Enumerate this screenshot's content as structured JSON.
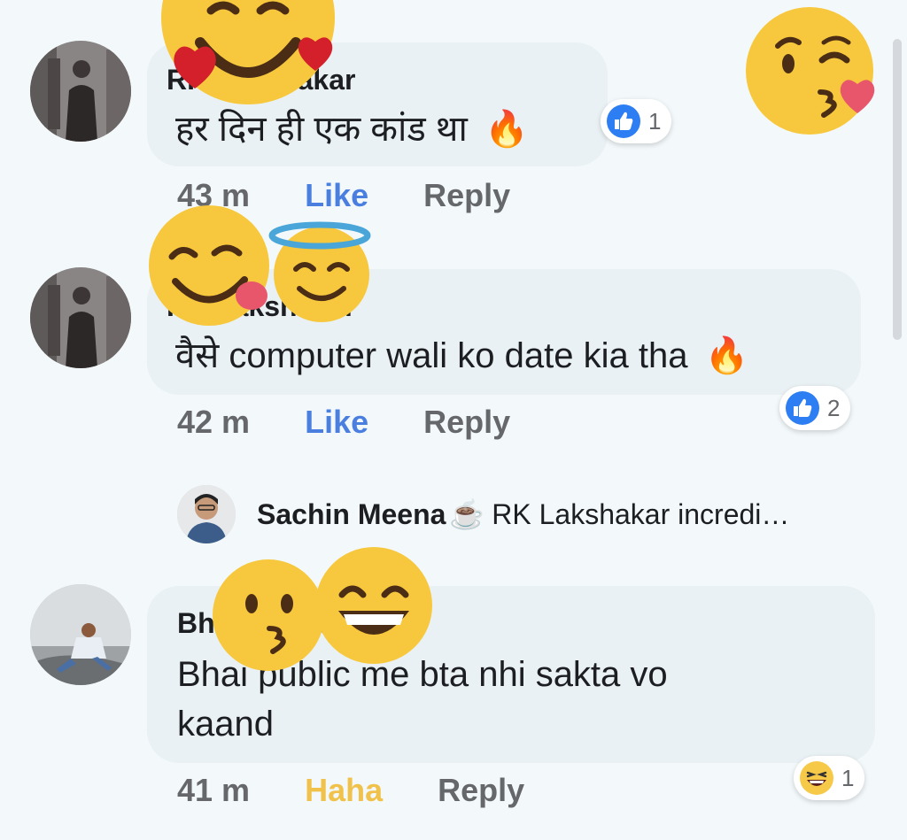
{
  "comments": [
    {
      "author": "RK Lakshakar",
      "text": "हर दिन ही एक कांड था",
      "emoji": "🔥",
      "time": "43 m",
      "action": "Like",
      "reply": "Reply",
      "reaction_count": "1",
      "reaction_type": "like-icon"
    },
    {
      "author": "RK Lakshakar",
      "text": "वैसे computer wali ko date kia tha",
      "emoji": "🔥",
      "time": "42 m",
      "action": "Like",
      "reply": "Reply",
      "reaction_count": "2",
      "reaction_type": "like-icon"
    },
    {
      "author": "Bhai Saheb",
      "text_line1": "Bhai public me bta nhi sakta vo",
      "text_line2": "kaand",
      "time": "41 m",
      "action": "Haha",
      "reply": "Reply",
      "reaction_count": "1",
      "reaction_type": "haha-icon"
    }
  ],
  "reply_preview": {
    "name": "Sachin Meena",
    "emoji": "☕",
    "text": "RK Lakshakar incredi…"
  },
  "colors": {
    "background": "#f3f9fb",
    "bubble": "#e9f1f4",
    "like_blue": "#4a7fe0",
    "haha_yellow": "#f0c24b",
    "meta_gray": "#65676b"
  }
}
